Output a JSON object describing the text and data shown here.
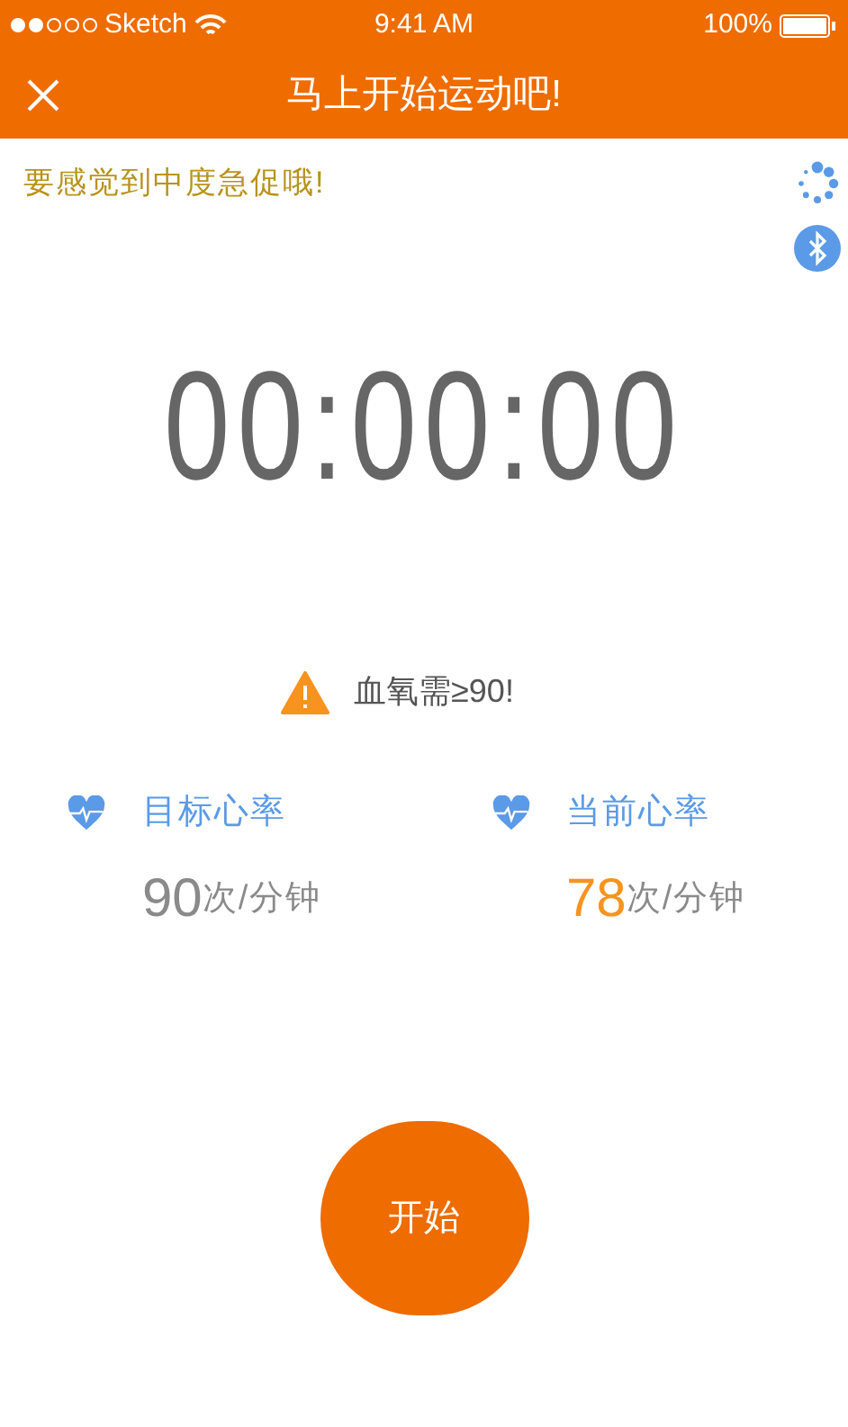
{
  "status_bar": {
    "carrier": "Sketch",
    "signal_dots": [
      {
        "filled": true
      },
      {
        "filled": true
      },
      {
        "filled": false
      },
      {
        "filled": false
      },
      {
        "filled": false
      }
    ],
    "time": "9:41 AM",
    "battery": "100%"
  },
  "header": {
    "title": "马上开始运动吧!"
  },
  "hint": "要感觉到中度急促哦!",
  "timer": "00:00:00",
  "warning": "血氧需≥90!",
  "stats": [
    {
      "kind": "target",
      "label": "目标心率",
      "value": "90",
      "unit": "次/分钟"
    },
    {
      "kind": "current",
      "label": "当前心率",
      "value": "78",
      "unit": "次/分钟"
    }
  ],
  "start_button": "开始"
}
